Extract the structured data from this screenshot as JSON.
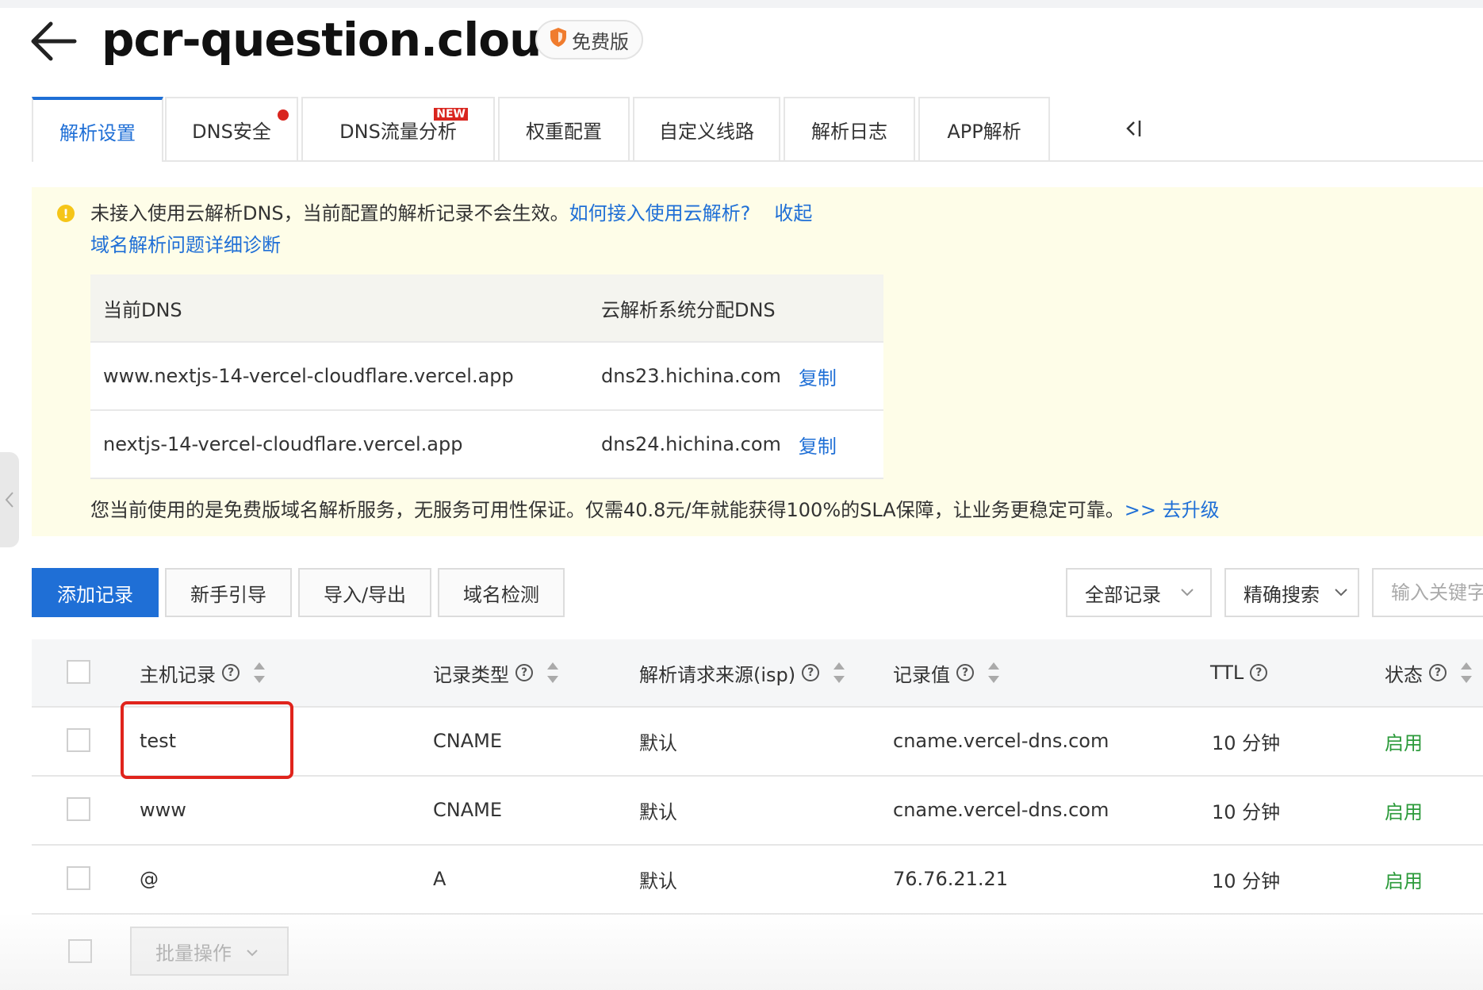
{
  "header": {
    "title": "pcr-question.cloud",
    "badge": "免费版"
  },
  "tabs": [
    {
      "label": "解析设置",
      "active": true
    },
    {
      "label": "DNS安全",
      "dot": true
    },
    {
      "label": "DNS流量分析",
      "tag": "NEW"
    },
    {
      "label": "权重配置"
    },
    {
      "label": "自定义线路"
    },
    {
      "label": "解析日志"
    },
    {
      "label": "APP解析"
    }
  ],
  "notice": {
    "message": "未接入使用云解析DNS，当前配置的解析记录不会生效。",
    "how_link": "如何接入使用云解析?",
    "collapse_link": "收起",
    "diagnose_link": "域名解析问题详细诊断",
    "table": {
      "headers": [
        "当前DNS",
        "云解析系统分配DNS"
      ],
      "rows": [
        {
          "current": "www.nextjs-14-vercel-cloudflare.vercel.app",
          "assigned": "dns23.hichina.com",
          "copy": "复制"
        },
        {
          "current": "nextjs-14-vercel-cloudflare.vercel.app",
          "assigned": "dns24.hichina.com",
          "copy": "复制"
        }
      ]
    },
    "footer": "您当前使用的是免费版域名解析服务，无服务可用性保证。仅需40.8元/年就能获得100%的SLA保障，让业务更稳定可靠。",
    "upgrade_link": ">> 去升级"
  },
  "toolbar": {
    "add": "添加记录",
    "guide": "新手引导",
    "import_export": "导入/导出",
    "check": "域名检测",
    "filter": "全部记录",
    "search_mode": "精确搜索",
    "search_placeholder": "输入关键字"
  },
  "records": {
    "headers": {
      "host": "主机记录",
      "type": "记录类型",
      "isp": "解析请求来源(isp)",
      "value": "记录值",
      "ttl": "TTL",
      "status": "状态"
    },
    "rows": [
      {
        "host": "test",
        "type": "CNAME",
        "isp": "默认",
        "value": "cname.vercel-dns.com",
        "ttl": "10 分钟",
        "status": "启用"
      },
      {
        "host": "www",
        "type": "CNAME",
        "isp": "默认",
        "value": "cname.vercel-dns.com",
        "ttl": "10 分钟",
        "status": "启用"
      },
      {
        "host": "@",
        "type": "A",
        "isp": "默认",
        "value": "76.76.21.21",
        "ttl": "10 分钟",
        "status": "启用"
      }
    ],
    "batch": "批量操作"
  },
  "colors": {
    "primary": "#1f6fd6",
    "notice_bg": "#fefde8",
    "status_on": "#2b9a3a",
    "highlight": "#e0241c",
    "dot": "#d9251e"
  }
}
